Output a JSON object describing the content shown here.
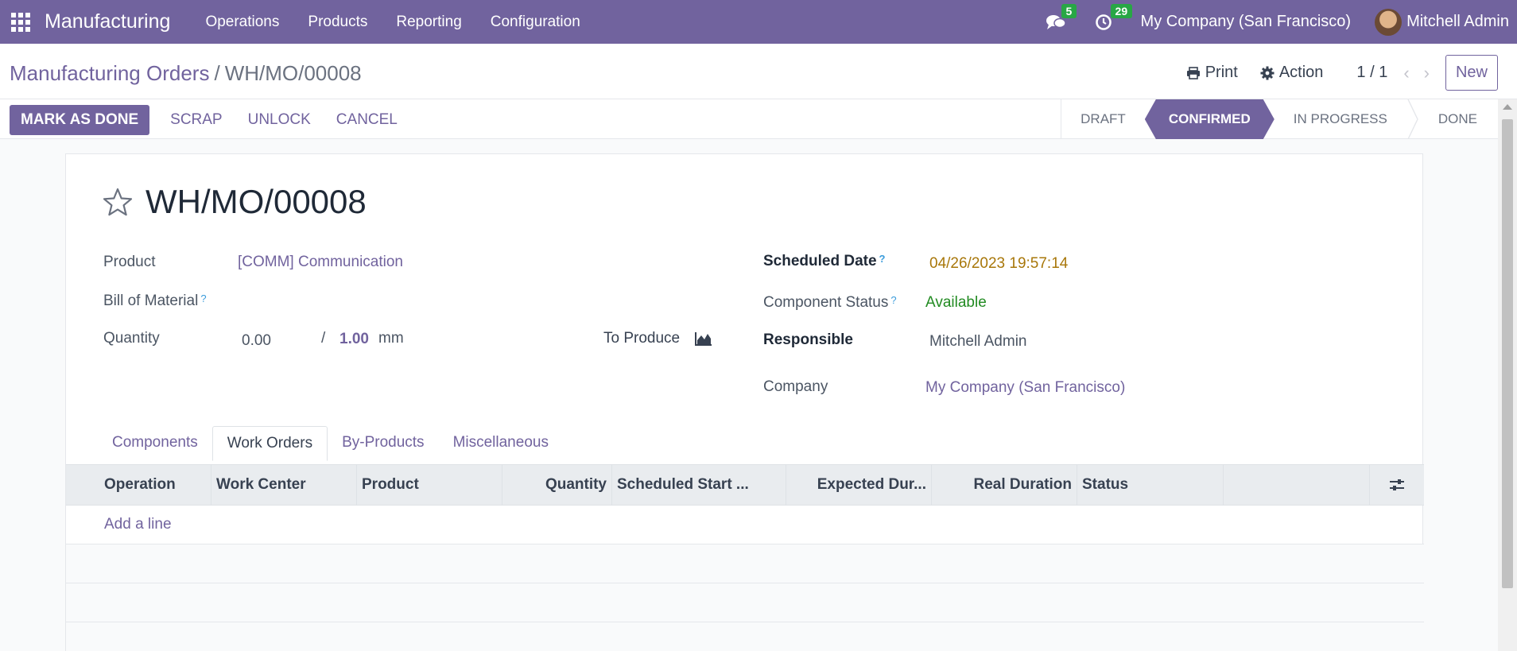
{
  "navbar": {
    "app_name": "Manufacturing",
    "menu": [
      "Operations",
      "Products",
      "Reporting",
      "Configuration"
    ],
    "messages_count": "5",
    "activities_count": "29",
    "company": "My Company (San Francisco)",
    "user": "Mitchell Admin"
  },
  "control_panel": {
    "breadcrumb_parent": "Manufacturing Orders",
    "breadcrumb_separator": "/",
    "breadcrumb_current": "WH/MO/00008",
    "print_label": "Print",
    "action_label": "Action",
    "pager": "1 / 1",
    "new_label": "New"
  },
  "statusbar": {
    "buttons": {
      "mark_done": "MARK AS DONE",
      "scrap": "SCRAP",
      "unlock": "UNLOCK",
      "cancel": "CANCEL"
    },
    "stages": [
      "DRAFT",
      "CONFIRMED",
      "IN PROGRESS",
      "DONE"
    ],
    "active_stage": "CONFIRMED"
  },
  "form": {
    "title": "WH/MO/00008",
    "product_label": "Product",
    "product_value": "[COMM] Communication",
    "bom_label": "Bill of Material",
    "help_mark": "?",
    "quantity_label": "Quantity",
    "quantity_produced": "0.00",
    "quantity_separator": "/",
    "quantity_total": "1.00",
    "uom": "mm",
    "to_produce_label": "To Produce",
    "scheduled_date_label": "Scheduled Date",
    "scheduled_date_value": "04/26/2023 19:57:14",
    "component_status_label": "Component Status",
    "component_status_value": "Available",
    "responsible_label": "Responsible",
    "responsible_value": "Mitchell Admin",
    "company_label": "Company",
    "company_value": "My Company (San Francisco)"
  },
  "tabs": [
    "Components",
    "Work Orders",
    "By-Products",
    "Miscellaneous"
  ],
  "active_tab": "Work Orders",
  "work_orders_table": {
    "columns": [
      "Operation",
      "Work Center",
      "Product",
      "Quantity",
      "Scheduled Start ...",
      "Expected Dur...",
      "Real Duration",
      "Status"
    ],
    "add_line": "Add a line"
  },
  "colors": {
    "brand": "#71639e",
    "badge": "#28a745",
    "warning": "#a8770a",
    "success": "#228b22"
  },
  "icons": [
    "apps-grid-icon",
    "chat-icon",
    "clock-icon",
    "print-icon",
    "gear-icon",
    "chevron-left-icon",
    "chevron-right-icon",
    "star-icon",
    "area-chart-icon",
    "column-settings-icon"
  ]
}
